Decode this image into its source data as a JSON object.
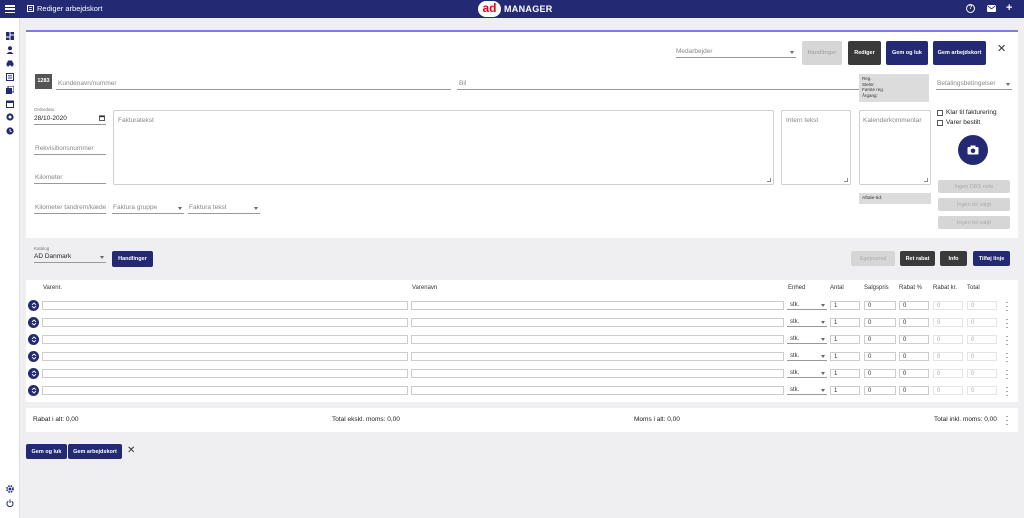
{
  "app": {
    "page_title": "Rediger arbejdskort",
    "brand_mark": "ad",
    "brand_name": "MANAGER"
  },
  "colors": {
    "primary": "#232a73",
    "accent_line": "#7b7be6",
    "dark_button": "#3a3a3a"
  },
  "header_actions": {
    "employee_placeholder": "Medarbejder",
    "handlinger_label": "Handlinger",
    "rediger_label": "Rediger",
    "save_close_label": "Gem og luk",
    "save_card_label": "Gem arbejdskort"
  },
  "customer": {
    "number_badge": "1283",
    "name_placeholder": "Kundenavn/nummer",
    "car_placeholder": "Bil"
  },
  "car_info": {
    "line1": "Reg.",
    "line2": "Stelnr.",
    "line3": "Første reg.",
    "line4": "Årgang:"
  },
  "payment": {
    "placeholder": "Betalingsbetingelser"
  },
  "order": {
    "date_label": "Ordredato",
    "date_value": "28/10-2020",
    "requisition_placeholder": "Rekvisitionsnummer",
    "km_placeholder": "Kilometer",
    "km_tandrem_placeholder": "Kilometer tandrem/kæde",
    "faktura_gruppe_placeholder": "Faktura gruppe",
    "faktura_tekst_placeholder": "Faktura tekst"
  },
  "texts": {
    "fakturatekst_placeholder": "Fakturatekst",
    "intern_tekst_placeholder": "Intern tekst",
    "kalender_placeholder": "Kalenderkommentar",
    "aftale_label": "Aftale-tid:"
  },
  "status": {
    "klar_label": "Klar til fakturering",
    "varer_label": "Varer bestilt"
  },
  "side_buttons": {
    "b1": "Ingen DBS note",
    "b2": "Ingen bil valgt",
    "b3": "Ingen bil valgt"
  },
  "catalog": {
    "label": "Katalog",
    "value": "AD Danmark",
    "handlinger_label": "Handlinger",
    "egejournal_label": "Egejournal",
    "ret_rabat_label": "Ret rabat",
    "info_label": "Info",
    "add_line_label": "Tilføj linje"
  },
  "table": {
    "headers": {
      "varenr": "Varenr.",
      "varenavn": "Varenavn",
      "enhed": "Enhed",
      "antal": "Antal",
      "salgspris": "Salgspris",
      "rabat_pct": "Rabat %",
      "rabat_kr": "Rabat kr.",
      "total": "Total"
    },
    "rows": [
      {
        "enhed": "stk.",
        "antal": "1",
        "salgspris": "0",
        "rabat_pct": "0",
        "rabat_kr": "0",
        "total": "0"
      },
      {
        "enhed": "stk.",
        "antal": "1",
        "salgspris": "0",
        "rabat_pct": "0",
        "rabat_kr": "0",
        "total": "0"
      },
      {
        "enhed": "stk.",
        "antal": "1",
        "salgspris": "0",
        "rabat_pct": "0",
        "rabat_kr": "0",
        "total": "0"
      },
      {
        "enhed": "stk.",
        "antal": "1",
        "salgspris": "0",
        "rabat_pct": "0",
        "rabat_kr": "0",
        "total": "0"
      },
      {
        "enhed": "stk.",
        "antal": "1",
        "salgspris": "0",
        "rabat_pct": "0",
        "rabat_kr": "0",
        "total": "0"
      },
      {
        "enhed": "stk.",
        "antal": "1",
        "salgspris": "0",
        "rabat_pct": "0",
        "rabat_kr": "0",
        "total": "0"
      }
    ]
  },
  "totals": {
    "rabat": "Rabat i alt: 0,00",
    "total_ex": "Total ekskl. moms: 0,00",
    "moms": "Moms i alt: 0,00",
    "total_inkl": "Total inkl. moms: 0,00"
  },
  "footer": {
    "save_close_label": "Gem og luk",
    "save_card_label": "Gem arbejdskort"
  }
}
